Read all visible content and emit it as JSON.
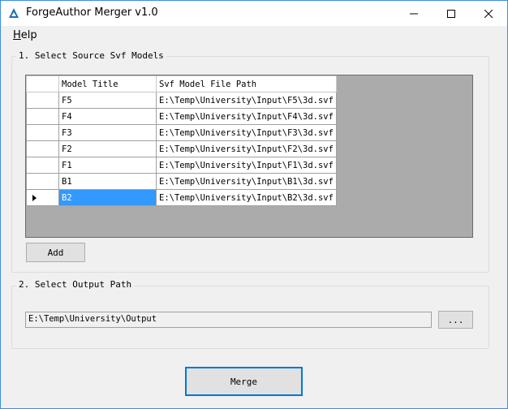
{
  "window": {
    "title": "ForgeAuthor Merger v1.0",
    "minimize_glyph": "—",
    "maximize_glyph": "☐",
    "close_glyph": "✕"
  },
  "menu": {
    "help_underlined": "H",
    "help_rest": "elp"
  },
  "section1": {
    "title": "1. Select Source Svf Models",
    "columns": [
      "Model Title",
      "Svf Model File Path"
    ],
    "rows": [
      {
        "title": "F5",
        "path": "E:\\Temp\\University\\Input\\F5\\3d.svf"
      },
      {
        "title": "F4",
        "path": "E:\\Temp\\University\\Input\\F4\\3d.svf"
      },
      {
        "title": "F3",
        "path": "E:\\Temp\\University\\Input\\F3\\3d.svf"
      },
      {
        "title": "F2",
        "path": "E:\\Temp\\University\\Input\\F2\\3d.svf"
      },
      {
        "title": "F1",
        "path": "E:\\Temp\\University\\Input\\F1\\3d.svf"
      },
      {
        "title": "B1",
        "path": "E:\\Temp\\University\\Input\\B1\\3d.svf"
      },
      {
        "title": "B2",
        "path": "E:\\Temp\\University\\Input\\B2\\3d.svf"
      }
    ],
    "selected_row": 6,
    "add_label": "Add"
  },
  "section2": {
    "title": "2. Select Output Path",
    "output_path": "E:\\Temp\\University\\Output",
    "browse_label": "..."
  },
  "merge_label": "Merge",
  "colors": {
    "accent": "#0078d7",
    "selection": "#3399ff",
    "grid_background": "#ababab"
  }
}
